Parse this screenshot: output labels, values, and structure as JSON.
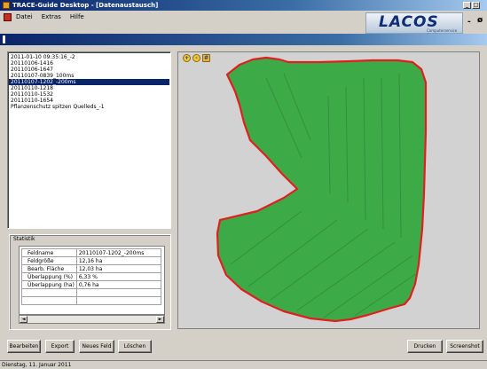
{
  "window": {
    "title": "TRACE-Guide Desktop - [Datenaustausch]"
  },
  "menu": {
    "items": [
      "Datei",
      "Extras",
      "Hilfe"
    ]
  },
  "logo": {
    "text": "LACOS",
    "subtitle": "Computerservice GmbH"
  },
  "fields": {
    "items": [
      "2011-01-10 09:35:16_-2",
      "20110106-1416",
      "20110106-1647",
      "20110107-0839_100ms",
      "20110107-1202_-200ms",
      "20110110-1218",
      "20110110-1532",
      "20110110-1654",
      "Pflanzenschutz spitzen Quelleds_-1"
    ],
    "selected_index": 4
  },
  "statistik": {
    "title": "Statistik",
    "rows": [
      {
        "key": "Feldname",
        "value": "20110107-1202_-200ms"
      },
      {
        "key": "Feldgröße",
        "value": "12,16 ha"
      },
      {
        "key": "Bearb. Fläche",
        "value": "12,03 ha"
      },
      {
        "key": "Überlappung (%)",
        "value": "6,33 %"
      },
      {
        "key": "Überlappung (ha)",
        "value": "0,76 ha"
      }
    ]
  },
  "map_tools": [
    "zoom-in-icon",
    "zoom-out-icon",
    "zoom-extent-icon"
  ],
  "colors": {
    "field_fill": "#3daa48",
    "field_border": "#e02020",
    "map_bg": "#d2d2d2"
  },
  "buttons": {
    "bearbeiten": "Bearbeiten",
    "export": "Export",
    "neues_feld": "Neues Feld",
    "loeschen": "Löschen",
    "drucken": "Drucken",
    "screenshot": "Screenshot"
  },
  "status": {
    "date": "Dienstag, 11. Januar 2011"
  }
}
